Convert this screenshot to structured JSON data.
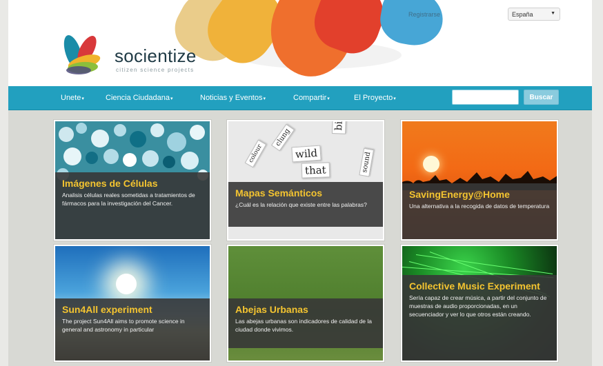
{
  "header": {
    "logo_name": "socientize",
    "logo_tagline": "citizen science projects",
    "register_link": "Registrarse",
    "language": {
      "selected": "España",
      "options": [
        "España"
      ]
    }
  },
  "nav": {
    "items": [
      "Unete",
      "Ciencia Ciudadana",
      "Noticias y Eventos",
      "Compartir",
      "El Proyecto"
    ],
    "search_placeholder": "",
    "search_button": "Buscar"
  },
  "colors": {
    "nav_background": "#22a0bf",
    "card_title": "#f4c430",
    "page_background": "#d8d9d4"
  },
  "cards": [
    {
      "title": "Imágenes de Células",
      "description": "Analisis células reales sometidas a tratamientos de fármacos para la investigación del Cancer.",
      "image": "microscope-cells"
    },
    {
      "title": "Mapas Semánticos",
      "description": "¿Cuál es la relación que existe entre las palabras?",
      "image": "word-cards",
      "image_words": [
        "wild",
        "that",
        "birthday",
        "clung",
        "colour",
        "sound"
      ]
    },
    {
      "title": "SavingEnergy@Home",
      "description": "Una alternativa a la recogida de datos de temperatura",
      "image": "sunset-silhouettes"
    },
    {
      "title": "Sun4All experiment",
      "description": "The project Sun4All aims to promote science in general and astronomy in particular",
      "image": "sun-sky"
    },
    {
      "title": "Abejas Urbanas",
      "description": "Las abejas urbanas son indicadores de calidad de la ciudad donde vivimos.",
      "image": "green-grass"
    },
    {
      "title": "Collective Music Experiment",
      "description": "Sería capaz de crear música, a partir del conjunto de muestras de audio proporcionadas, en un secuenciador y ver lo que otros están creando.",
      "image": "green-laser-lights"
    }
  ]
}
